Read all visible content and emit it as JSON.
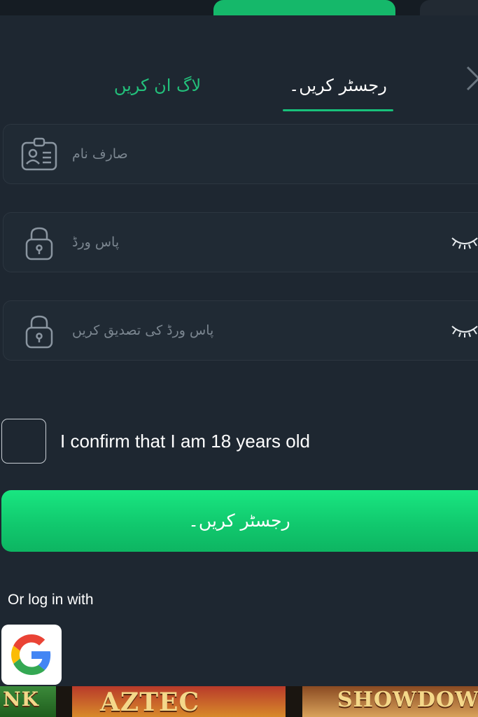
{
  "tabs": {
    "login_label": "لاگ ان کریں",
    "register_label": "رجسٹر کریں۔"
  },
  "form": {
    "username_placeholder": "صارف نام",
    "password_placeholder": "پاس ورڈ",
    "confirm_password_placeholder": "پاس ورڈ کی تصدیق کریں"
  },
  "age_confirm": {
    "label": "I confirm that I am 18 years old",
    "checked": false
  },
  "submit_label": "رجسٹر کریں۔",
  "social": {
    "heading": "Or log in with",
    "providers": [
      {
        "name": "Google",
        "icon": "google-icon"
      }
    ]
  },
  "games": [
    {
      "title": "NK"
    },
    {
      "title": "AZTEC"
    },
    {
      "title": "SHOWDOWN"
    }
  ],
  "colors": {
    "background": "#1e2731",
    "accent": "#18c17a",
    "field_bg": "#202a34",
    "placeholder": "#7b8690"
  },
  "icons": {
    "username": "id-badge-icon",
    "password": "lock-icon",
    "reveal": "eye-closed-icon",
    "close": "close-icon"
  }
}
